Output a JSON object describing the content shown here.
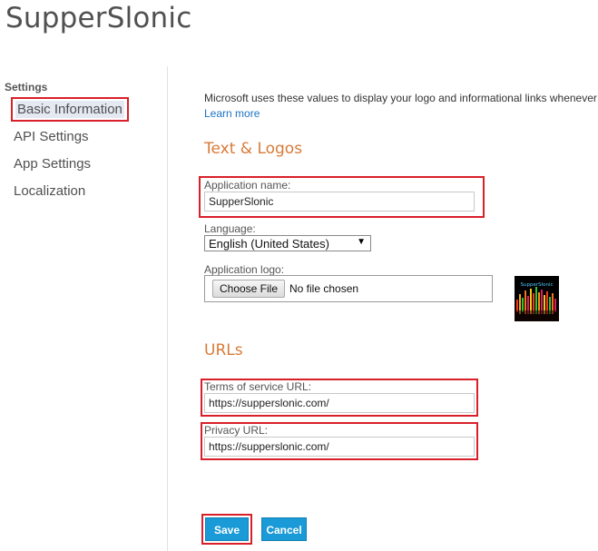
{
  "app": {
    "title": "SupperSlonic"
  },
  "sidebar": {
    "heading": "Settings",
    "items": [
      {
        "label": "Basic Information"
      },
      {
        "label": "API Settings"
      },
      {
        "label": "App Settings"
      },
      {
        "label": "Localization"
      }
    ]
  },
  "main": {
    "intro": "Microsoft uses these values to display your logo and informational links whenever",
    "learn_more": "Learn more",
    "text_logos_heading": "Text & Logos",
    "app_name": {
      "label": "Application name:",
      "value": "SupperSlonic"
    },
    "language": {
      "label": "Language:",
      "selected": "English (United States)"
    },
    "logo": {
      "label": "Application logo:",
      "button": "Choose File",
      "status": "No file chosen",
      "thumb_text": "SupperSlonic"
    },
    "urls_heading": "URLs",
    "tos": {
      "label": "Terms of service URL:",
      "value": "https://supperslonic.com/"
    },
    "privacy": {
      "label": "Privacy URL:",
      "value": "https://supperslonic.com/"
    }
  },
  "actions": {
    "save": "Save",
    "cancel": "Cancel"
  },
  "colors": {
    "accent_orange": "#d97a37",
    "highlight_red": "#d9202a",
    "button_blue": "#1a9ad6",
    "link_blue": "#1a73c4"
  }
}
